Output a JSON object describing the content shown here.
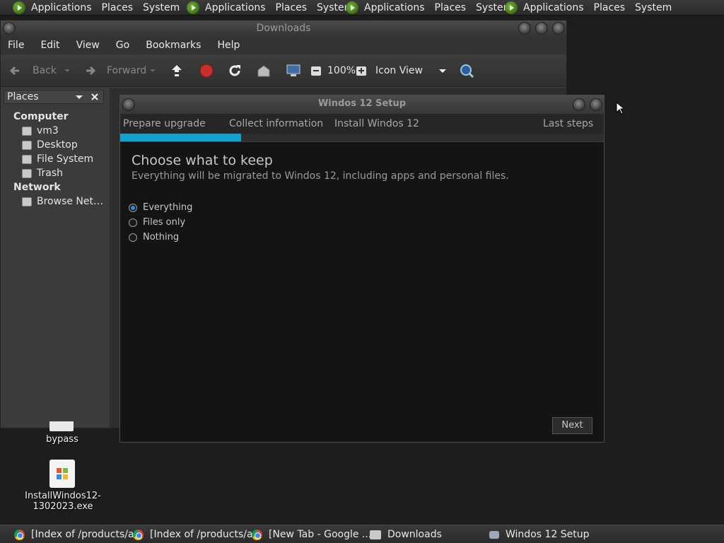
{
  "top_panel": {
    "groups": [
      {
        "applications": "Applications",
        "places": "Places",
        "system": "System"
      },
      {
        "applications": "Applications",
        "places": "Places",
        "system": "System"
      },
      {
        "applications": "Applications",
        "places": "Places",
        "system": "System"
      },
      {
        "applications": "Applications",
        "places": "Places",
        "system": "System"
      }
    ]
  },
  "file_manager": {
    "title": "Downloads",
    "menu": [
      "File",
      "Edit",
      "View",
      "Go",
      "Bookmarks",
      "Help"
    ],
    "toolbar": {
      "back": "Back",
      "forward": "Forward",
      "zoom": "100%",
      "view_mode": "Icon View"
    },
    "sidebar": {
      "header": "Places",
      "computer_section": "Computer",
      "computer_items": [
        "vm3",
        "Desktop",
        "File System",
        "Trash"
      ],
      "network_section": "Network",
      "network_items": [
        "Browse Net…"
      ]
    }
  },
  "desktop": {
    "icons": [
      {
        "label": "bypass"
      },
      {
        "label": "InstallWindos12-\n1302023.exe"
      }
    ]
  },
  "setup_window": {
    "title": "Windos 12 Setup",
    "steps": [
      "Prepare upgrade",
      "Collect information",
      "Install Windos 12",
      "Last steps"
    ],
    "progress": 0.25,
    "heading": "Choose what to keep",
    "subheading": "Everything will be migrated to Windos 12, including apps and personal files.",
    "options": [
      "Everything",
      "Files only",
      "Nothing"
    ],
    "selected_option": "Everything",
    "next_label": "Next"
  },
  "taskbar": {
    "tasks": [
      {
        "label": "[Index of /products/a...",
        "icon": "chrome-icon"
      },
      {
        "label": "[Index of /products/a...",
        "icon": "chrome-icon"
      },
      {
        "label": "[New Tab - Google ...",
        "icon": "chrome-icon"
      },
      {
        "label": "Downloads",
        "icon": "folder-icon"
      },
      {
        "label": "Windos 12 Setup",
        "icon": "setup-icon"
      }
    ]
  },
  "colors": {
    "accent_progress": "#11a3cf",
    "radio_selected": "#2b8de0"
  }
}
